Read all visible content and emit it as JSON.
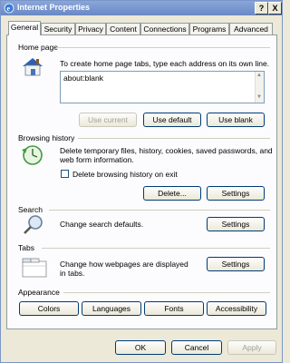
{
  "window": {
    "title": "Internet Properties"
  },
  "titlebar": {
    "help_label": "?",
    "close_label": "X"
  },
  "tabs": [
    {
      "label": "General"
    },
    {
      "label": "Security"
    },
    {
      "label": "Privacy"
    },
    {
      "label": "Content"
    },
    {
      "label": "Connections"
    },
    {
      "label": "Programs"
    },
    {
      "label": "Advanced"
    }
  ],
  "home_page": {
    "legend": "Home page",
    "description": "To create home page tabs, type each address on its own line.",
    "value": "about:blank",
    "use_current": "Use current",
    "use_default": "Use default",
    "use_blank": "Use blank"
  },
  "browsing_history": {
    "legend": "Browsing history",
    "description": "Delete temporary files, history, cookies, saved passwords, and web form information.",
    "checkbox_label": "Delete browsing history on exit",
    "delete_button": "Delete...",
    "settings_button": "Settings"
  },
  "search": {
    "legend": "Search",
    "description": "Change search defaults.",
    "settings_button": "Settings"
  },
  "tabs_section": {
    "legend": "Tabs",
    "description": "Change how webpages are displayed in tabs.",
    "settings_button": "Settings"
  },
  "appearance": {
    "legend": "Appearance",
    "colors": "Colors",
    "languages": "Languages",
    "fonts": "Fonts",
    "accessibility": "Accessibility"
  },
  "footer": {
    "ok": "OK",
    "cancel": "Cancel",
    "apply": "Apply"
  }
}
